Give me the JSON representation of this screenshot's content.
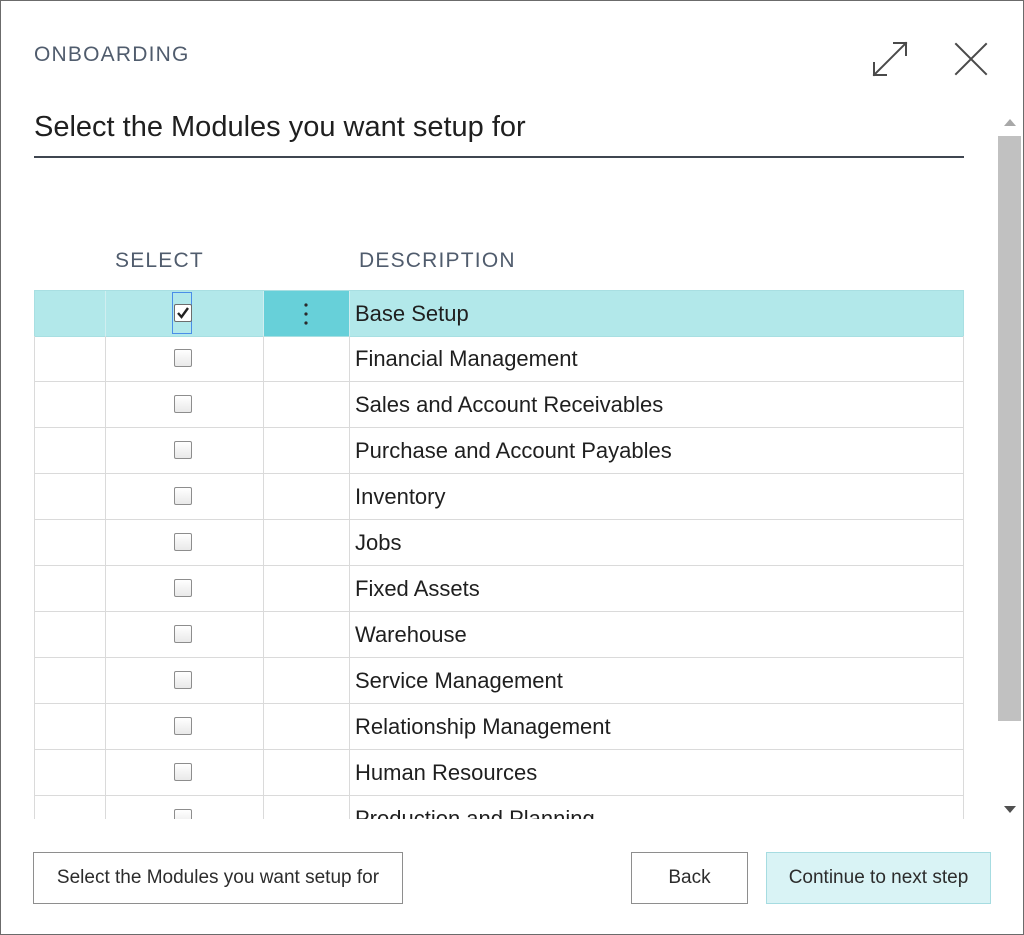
{
  "dialog": {
    "caption": "ONBOARDING",
    "title": "Select the Modules you want setup for"
  },
  "grid": {
    "columns": {
      "select": "SELECT",
      "description": "DESCRIPTION"
    },
    "rows": [
      {
        "description": "Base Setup",
        "checked": true,
        "selected": true
      },
      {
        "description": "Financial Management",
        "checked": false,
        "selected": false
      },
      {
        "description": "Sales and Account Receivables",
        "checked": false,
        "selected": false
      },
      {
        "description": "Purchase and Account Payables",
        "checked": false,
        "selected": false
      },
      {
        "description": "Inventory",
        "checked": false,
        "selected": false
      },
      {
        "description": "Jobs",
        "checked": false,
        "selected": false
      },
      {
        "description": "Fixed Assets",
        "checked": false,
        "selected": false
      },
      {
        "description": "Warehouse",
        "checked": false,
        "selected": false
      },
      {
        "description": "Service Management",
        "checked": false,
        "selected": false
      },
      {
        "description": "Relationship Management",
        "checked": false,
        "selected": false
      },
      {
        "description": "Human Resources",
        "checked": false,
        "selected": false
      },
      {
        "description": "Production and Planning",
        "checked": false,
        "selected": false
      }
    ]
  },
  "footer": {
    "action_label": "Select the Modules you want setup for",
    "back_label": "Back",
    "continue_label": "Continue to next step"
  },
  "icons": {
    "expand": "expand-icon",
    "close": "close-icon",
    "row_actions": "ellipsis-vertical-icon",
    "checkmark": "checkmark-icon"
  },
  "colors": {
    "selected_row": "#b2e8ea",
    "action_cell": "#67d0d9",
    "primary_button": "#d9f3f5",
    "header_text": "#505c6d"
  }
}
